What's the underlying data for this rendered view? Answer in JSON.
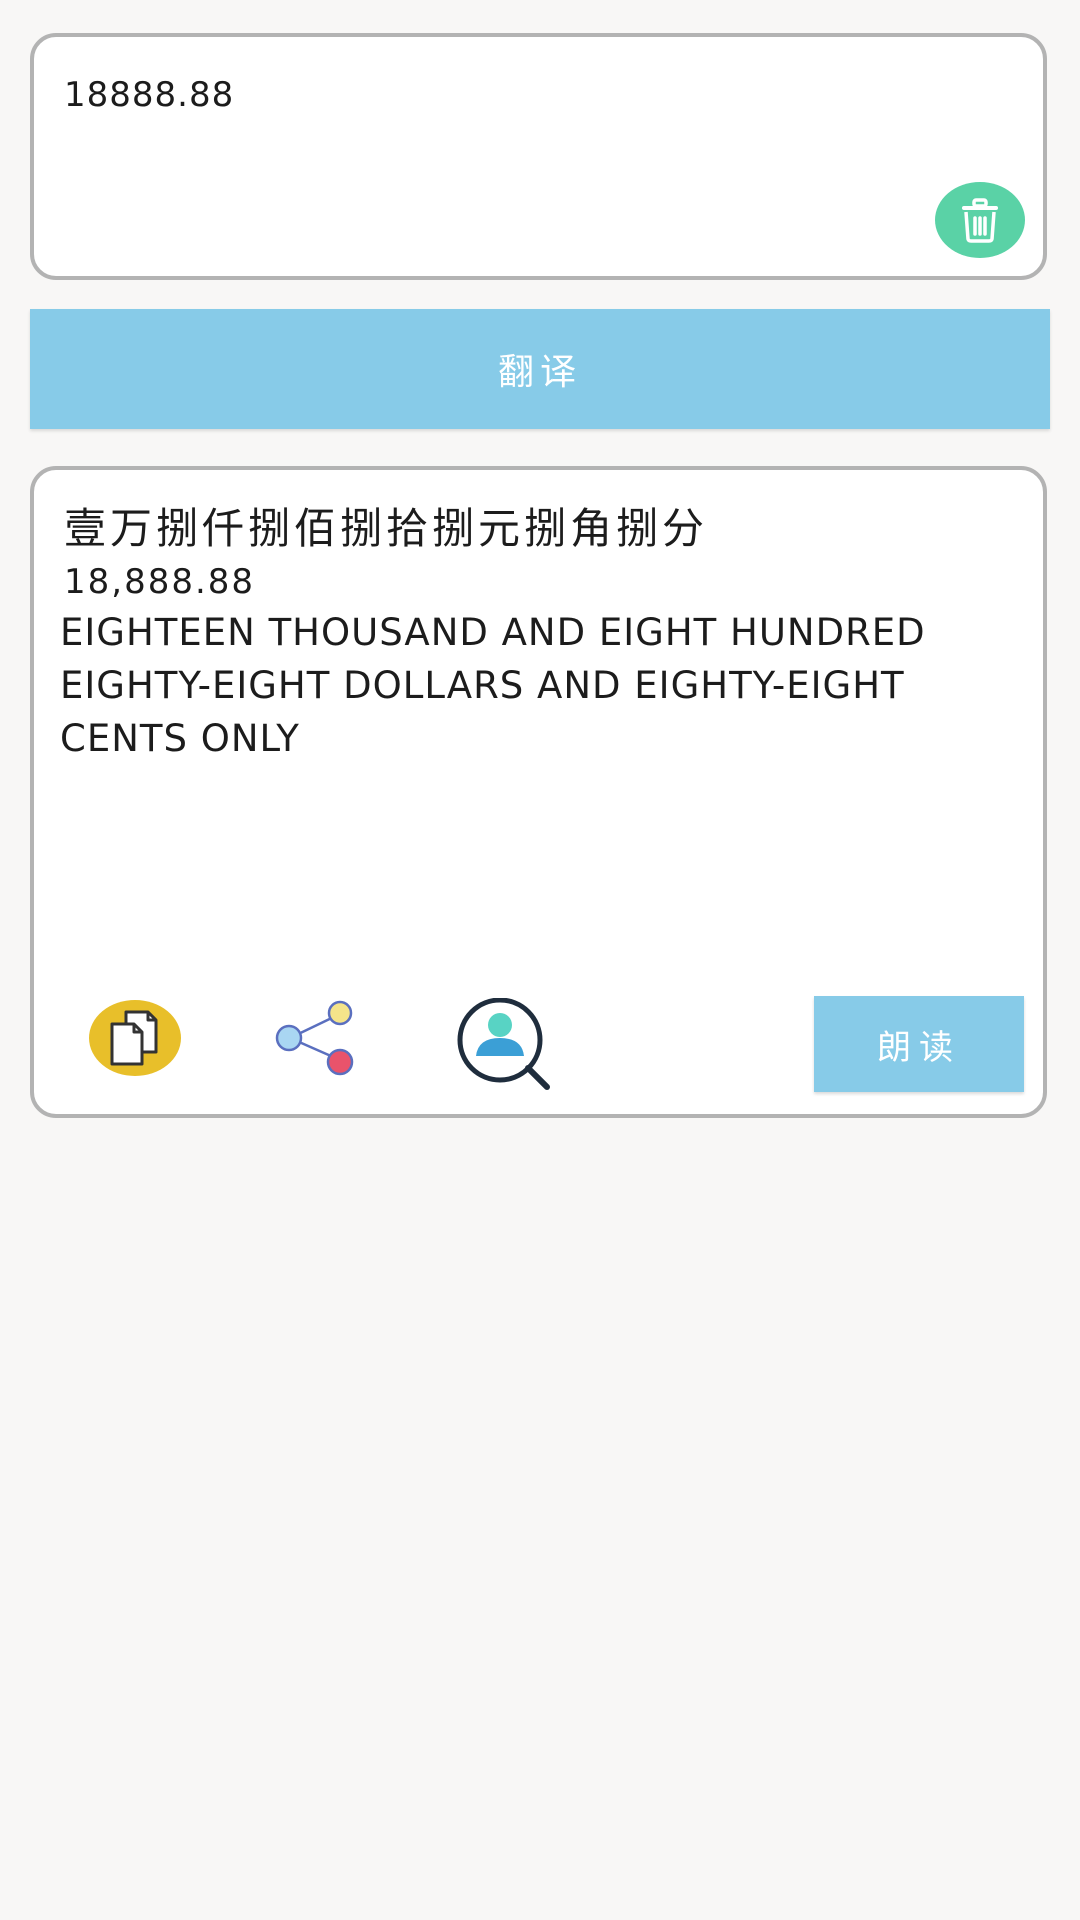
{
  "input": {
    "value": "18888.88"
  },
  "actions": {
    "clear_icon": "trash-icon",
    "translate_label": "翻译"
  },
  "result": {
    "chinese_uppercase": "壹万捌仟捌佰捌拾捌元捌角捌分",
    "formatted_number": "18,888.88",
    "english_words": "EIGHTEEN THOUSAND AND EIGHT HUNDRED EIGHTY-EIGHT DOLLARS AND EIGHTY-EIGHT CENTS ONLY"
  },
  "result_actions": {
    "copy_icon": "copy-icon",
    "share_icon": "share-icon",
    "search_icon": "search-user-icon",
    "read_label": "朗读"
  },
  "colors": {
    "accent": "#87cbe8",
    "clear_button": "#5ad2a6",
    "copy_button": "#e8bf2a",
    "card_border": "#b3b3b3",
    "background": "#f8f7f6"
  }
}
